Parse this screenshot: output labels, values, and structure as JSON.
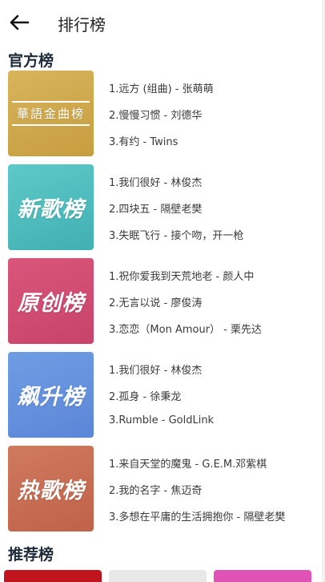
{
  "header": {
    "title": "排行榜"
  },
  "sections": {
    "official": "官方榜",
    "recommend": "推荐榜"
  },
  "charts": [
    {
      "cover_label": "華語金曲榜",
      "color_top": "#d8b45c",
      "color_bottom": "#c79d3f",
      "songs": [
        "1.远方 (组曲) - 张萌萌",
        "2.慢慢习惯 - 刘德华",
        "3.有约 - Twins"
      ]
    },
    {
      "cover_label": "新歌榜",
      "color_top": "#5ec9c8",
      "color_bottom": "#41b0b3",
      "songs": [
        "1.我们很好 - 林俊杰",
        "2.四块五 - 隔壁老樊",
        "3.失眠飞行 - 接个吻，开一枪"
      ]
    },
    {
      "cover_label": "原创榜",
      "color_top": "#d9567a",
      "color_bottom": "#c8436a",
      "songs": [
        "1.祝你爱我到天荒地老 - 颜人中",
        "2.无言以说 - 廖俊涛",
        "3.恋恋（Mon Amour） - 栗先达"
      ]
    },
    {
      "cover_label": "飙升榜",
      "color_top": "#6f9de3",
      "color_bottom": "#5b86d8",
      "songs": [
        "1.我们很好 - 林俊杰",
        "2.孤身 - 徐秉龙",
        "3.Rumble - GoldLink"
      ]
    },
    {
      "cover_label": "热歌榜",
      "color_top": "#cf7a5e",
      "color_bottom": "#c0624a",
      "songs": [
        "1.来自天堂的魔鬼 - G.E.M.邓紫棋",
        "2.我的名字 - 焦迈奇",
        "3.多想在平庸的生活拥抱你 - 隔壁老樊"
      ]
    }
  ],
  "recommend_thumbs": [
    {
      "color": "#c0141e"
    },
    {
      "color": "#e8e8e8"
    },
    {
      "color": "#e052b5"
    }
  ]
}
